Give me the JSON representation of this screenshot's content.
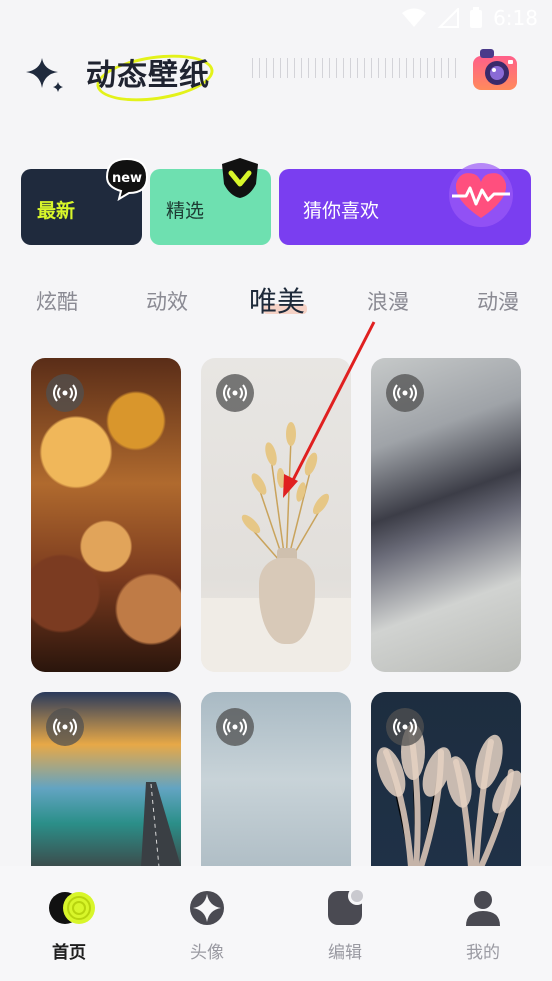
{
  "status_bar": {
    "time": "6:18"
  },
  "header": {
    "title": "动态壁纸",
    "sparkle_icon": "sparkle-icon",
    "camera_icon": "camera-icon"
  },
  "categories": [
    {
      "label": "最新",
      "badge": "new",
      "color": "#1f2a3d"
    },
    {
      "label": "精选",
      "badge": "check",
      "color": "#6ee0b0"
    },
    {
      "label": "猜你喜欢",
      "badge": "heart",
      "color": "#7a3ef0"
    }
  ],
  "tabs": [
    {
      "label": "炫酷"
    },
    {
      "label": "动效"
    },
    {
      "label": "唯美",
      "active": true
    },
    {
      "label": "浪漫"
    },
    {
      "label": "动漫"
    }
  ],
  "wallpapers": [
    {
      "name": "crowd-cheering",
      "live": true
    },
    {
      "name": "dried-flower-vase",
      "live": true
    },
    {
      "name": "abstract-paint",
      "live": true
    },
    {
      "name": "sunset-bridge",
      "live": true
    },
    {
      "name": "snow-frost",
      "live": true
    },
    {
      "name": "pampas-grass",
      "live": true
    }
  ],
  "bottom_nav": [
    {
      "label": "首页",
      "icon": "home-icon",
      "active": true
    },
    {
      "label": "头像",
      "icon": "avatar-icon"
    },
    {
      "label": "编辑",
      "icon": "edit-icon"
    },
    {
      "label": "我的",
      "icon": "profile-icon"
    }
  ],
  "colors": {
    "accent": "#d8f62a",
    "purple": "#7a3ef0",
    "arrow": "#e02020"
  }
}
